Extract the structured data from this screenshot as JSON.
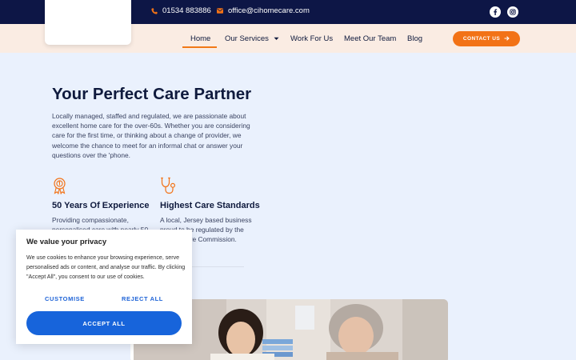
{
  "topbar": {
    "phone": "01534 883886",
    "email": "office@cihomecare.com",
    "social": [
      {
        "icon": "facebook-icon"
      },
      {
        "icon": "instagram-icon"
      }
    ]
  },
  "nav": {
    "items": [
      {
        "label": "Home",
        "active": true
      },
      {
        "label": "Our Services",
        "has_dropdown": true
      },
      {
        "label": "Work For Us"
      },
      {
        "label": "Meet Our Team"
      },
      {
        "label": "Blog"
      }
    ],
    "cta_label": "CONTACT US"
  },
  "hero": {
    "title": "Your Perfect Care Partner",
    "paragraph": "Locally managed, staffed and regulated, we are passionate about excellent home care for the over-60s. Whether you are considering care for the first time, or thinking about a change of provider, we welcome the chance to meet for an informal chat or answer your questions over the 'phone."
  },
  "features": [
    {
      "icon": "award-ribbon-icon",
      "title": "50 Years Of Experience",
      "text": "Providing compassionate, personalised care with nearly 50"
    },
    {
      "icon": "stethoscope-icon",
      "title": "Highest Care Standards",
      "text": "A local, Jersey based business proud to be regulated by the Jersey Care Commission."
    }
  ],
  "cookie": {
    "title": "We value your privacy",
    "text": "We use cookies to enhance your browsing experience, serve personalised ads or content, and analyse our traffic. By clicking \"Accept All\", you consent to our use of cookies.",
    "customise_label": "CUSTOMISE",
    "reject_label": "REJECT ALL",
    "accept_label": "ACCEPT ALL"
  },
  "colors": {
    "topbar": "#0d1646",
    "navbar": "#faece3",
    "accent": "#f27216",
    "page_bg": "#eaf1fd",
    "cookie_button": "#1764db"
  }
}
